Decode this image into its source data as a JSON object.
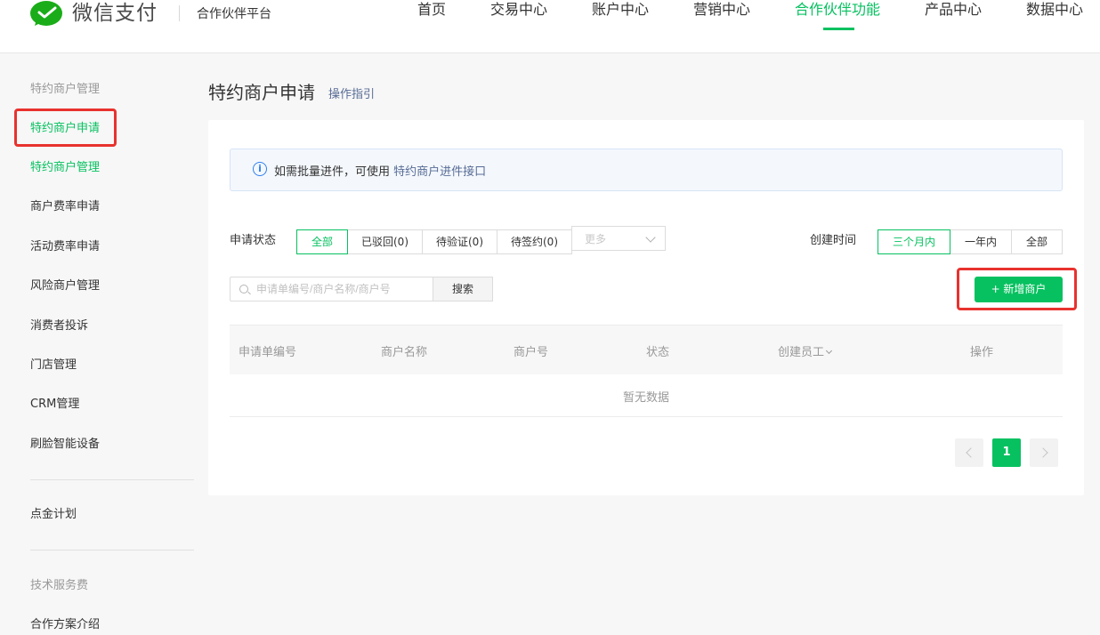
{
  "header": {
    "logo_text": "微信支付",
    "platform": "合作伙伴平台",
    "nav": [
      "首页",
      "交易中心",
      "账户中心",
      "营销中心",
      "合作伙伴功能",
      "产品中心",
      "数据中心"
    ],
    "active_nav": "合作伙伴功能"
  },
  "sidebar": {
    "group1": "特约商户管理",
    "items": [
      "特约商户申请",
      "特约商户管理",
      "商户费率申请",
      "活动费率申请",
      "风险商户管理",
      "消费者投诉",
      "门店管理",
      "CRM管理",
      "刷脸智能设备"
    ],
    "item2": "点金计划",
    "group2": "技术服务费",
    "item3": "合作方案介绍"
  },
  "page": {
    "title": "特约商户申请",
    "guide_link": "操作指引"
  },
  "notice": {
    "icon": "info-icon",
    "text": "如需批量进件，可使用 ",
    "link": "特约商户进件接口"
  },
  "filters": {
    "status_label": "申请状态",
    "status_tabs": [
      "全部",
      "已驳回(0)",
      "待验证(0)",
      "待签约(0)"
    ],
    "more_placeholder": "更多",
    "time_label": "创建时间",
    "time_tabs": [
      "三个月内",
      "一年内",
      "全部"
    ]
  },
  "search": {
    "placeholder": "申请单编号/商户名称/商户号",
    "button": "搜索"
  },
  "add_button": "+ 新增商户",
  "table": {
    "headers": [
      "申请单编号",
      "商户名称",
      "商户号",
      "状态",
      "创建员工",
      "操作"
    ],
    "empty": "暂无数据"
  },
  "pagination": {
    "current": "1"
  },
  "colors": {
    "brand": "#07c160",
    "link": "#576b95",
    "highlight": "#e8322e"
  }
}
